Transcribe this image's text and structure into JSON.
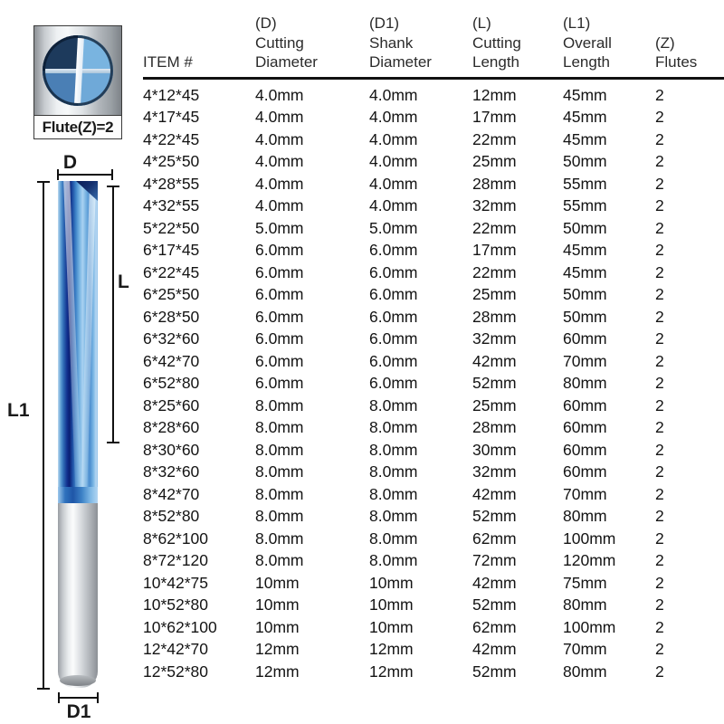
{
  "diagram": {
    "endview": {
      "name": "end-view-cross-section",
      "flute_label": "Flute(Z)=2"
    },
    "dimensions": {
      "D": "D",
      "L": "L",
      "L1": "L1",
      "D1": "D1"
    },
    "colors": {
      "flute_dark_blue": "#0b1f74",
      "flute_mid_blue": "#2f6bb5",
      "flute_light_blue": "#a9d2f1",
      "shank_silver": "#c5c9cd"
    }
  },
  "table": {
    "columns": [
      {
        "code": "",
        "line1": "",
        "line2": "ITEM #"
      },
      {
        "code": "(D)",
        "line1": "Cutting",
        "line2": "Diameter"
      },
      {
        "code": "(D1)",
        "line1": "Shank",
        "line2": "Diameter"
      },
      {
        "code": "(L)",
        "line1": "Cutting",
        "line2": "Length"
      },
      {
        "code": "(L1)",
        "line1": "Overall",
        "line2": "Length"
      },
      {
        "code": "(Z)",
        "line1": "",
        "line2": "Flutes"
      }
    ],
    "rows": [
      {
        "item": "4*12*45",
        "cutting_diameter": "4.0mm",
        "shank_diameter": "4.0mm",
        "cutting_length": "12mm",
        "overall_length": "45mm",
        "flutes": "2"
      },
      {
        "item": "4*17*45",
        "cutting_diameter": "4.0mm",
        "shank_diameter": "4.0mm",
        "cutting_length": "17mm",
        "overall_length": "45mm",
        "flutes": "2"
      },
      {
        "item": "4*22*45",
        "cutting_diameter": "4.0mm",
        "shank_diameter": "4.0mm",
        "cutting_length": "22mm",
        "overall_length": "45mm",
        "flutes": "2"
      },
      {
        "item": "4*25*50",
        "cutting_diameter": "4.0mm",
        "shank_diameter": "4.0mm",
        "cutting_length": "25mm",
        "overall_length": "50mm",
        "flutes": "2"
      },
      {
        "item": "4*28*55",
        "cutting_diameter": "4.0mm",
        "shank_diameter": "4.0mm",
        "cutting_length": "28mm",
        "overall_length": "55mm",
        "flutes": "2"
      },
      {
        "item": "4*32*55",
        "cutting_diameter": "4.0mm",
        "shank_diameter": "4.0mm",
        "cutting_length": "32mm",
        "overall_length": "55mm",
        "flutes": "2"
      },
      {
        "item": "5*22*50",
        "cutting_diameter": "5.0mm",
        "shank_diameter": "5.0mm",
        "cutting_length": "22mm",
        "overall_length": "50mm",
        "flutes": "2"
      },
      {
        "item": "6*17*45",
        "cutting_diameter": "6.0mm",
        "shank_diameter": "6.0mm",
        "cutting_length": "17mm",
        "overall_length": "45mm",
        "flutes": "2"
      },
      {
        "item": "6*22*45",
        "cutting_diameter": "6.0mm",
        "shank_diameter": "6.0mm",
        "cutting_length": "22mm",
        "overall_length": "45mm",
        "flutes": "2"
      },
      {
        "item": "6*25*50",
        "cutting_diameter": "6.0mm",
        "shank_diameter": "6.0mm",
        "cutting_length": "25mm",
        "overall_length": "50mm",
        "flutes": "2"
      },
      {
        "item": "6*28*50",
        "cutting_diameter": "6.0mm",
        "shank_diameter": "6.0mm",
        "cutting_length": "28mm",
        "overall_length": "50mm",
        "flutes": "2"
      },
      {
        "item": "6*32*60",
        "cutting_diameter": "6.0mm",
        "shank_diameter": "6.0mm",
        "cutting_length": "32mm",
        "overall_length": "60mm",
        "flutes": "2"
      },
      {
        "item": "6*42*70",
        "cutting_diameter": "6.0mm",
        "shank_diameter": "6.0mm",
        "cutting_length": "42mm",
        "overall_length": "70mm",
        "flutes": "2"
      },
      {
        "item": "6*52*80",
        "cutting_diameter": "6.0mm",
        "shank_diameter": "6.0mm",
        "cutting_length": "52mm",
        "overall_length": "80mm",
        "flutes": "2"
      },
      {
        "item": "8*25*60",
        "cutting_diameter": "8.0mm",
        "shank_diameter": "8.0mm",
        "cutting_length": "25mm",
        "overall_length": "60mm",
        "flutes": "2"
      },
      {
        "item": "8*28*60",
        "cutting_diameter": "8.0mm",
        "shank_diameter": "8.0mm",
        "cutting_length": "28mm",
        "overall_length": "60mm",
        "flutes": "2"
      },
      {
        "item": "8*30*60",
        "cutting_diameter": "8.0mm",
        "shank_diameter": "8.0mm",
        "cutting_length": "30mm",
        "overall_length": "60mm",
        "flutes": "2"
      },
      {
        "item": "8*32*60",
        "cutting_diameter": "8.0mm",
        "shank_diameter": "8.0mm",
        "cutting_length": "32mm",
        "overall_length": "60mm",
        "flutes": "2"
      },
      {
        "item": "8*42*70",
        "cutting_diameter": "8.0mm",
        "shank_diameter": "8.0mm",
        "cutting_length": "42mm",
        "overall_length": "70mm",
        "flutes": "2"
      },
      {
        "item": "8*52*80",
        "cutting_diameter": "8.0mm",
        "shank_diameter": "8.0mm",
        "cutting_length": "52mm",
        "overall_length": "80mm",
        "flutes": "2"
      },
      {
        "item": "8*62*100",
        "cutting_diameter": "8.0mm",
        "shank_diameter": "8.0mm",
        "cutting_length": "62mm",
        "overall_length": "100mm",
        "flutes": "2"
      },
      {
        "item": "8*72*120",
        "cutting_diameter": "8.0mm",
        "shank_diameter": "8.0mm",
        "cutting_length": "72mm",
        "overall_length": "120mm",
        "flutes": "2"
      },
      {
        "item": "10*42*75",
        "cutting_diameter": "10mm",
        "shank_diameter": "10mm",
        "cutting_length": "42mm",
        "overall_length": "75mm",
        "flutes": "2"
      },
      {
        "item": "10*52*80",
        "cutting_diameter": "10mm",
        "shank_diameter": "10mm",
        "cutting_length": "52mm",
        "overall_length": "80mm",
        "flutes": "2"
      },
      {
        "item": "10*62*100",
        "cutting_diameter": "10mm",
        "shank_diameter": "10mm",
        "cutting_length": "62mm",
        "overall_length": "100mm",
        "flutes": "2"
      },
      {
        "item": "12*42*70",
        "cutting_diameter": "12mm",
        "shank_diameter": "12mm",
        "cutting_length": "42mm",
        "overall_length": "70mm",
        "flutes": "2"
      },
      {
        "item": "12*52*80",
        "cutting_diameter": "12mm",
        "shank_diameter": "12mm",
        "cutting_length": "52mm",
        "overall_length": "80mm",
        "flutes": "2"
      }
    ]
  }
}
